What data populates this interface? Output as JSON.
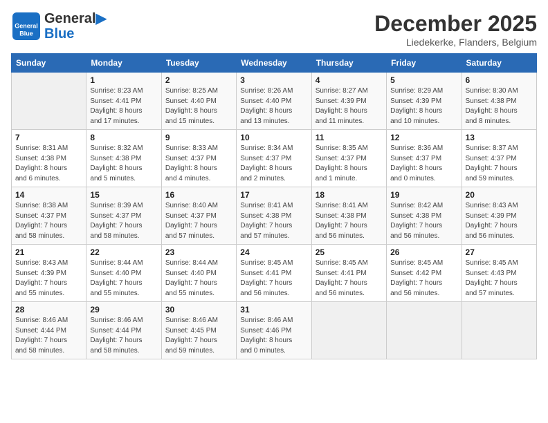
{
  "header": {
    "logo_line1": "General",
    "logo_line2": "Blue",
    "month": "December 2025",
    "location": "Liedekerke, Flanders, Belgium"
  },
  "weekdays": [
    "Sunday",
    "Monday",
    "Tuesday",
    "Wednesday",
    "Thursday",
    "Friday",
    "Saturday"
  ],
  "weeks": [
    [
      {
        "day": "",
        "info": ""
      },
      {
        "day": "1",
        "info": "Sunrise: 8:23 AM\nSunset: 4:41 PM\nDaylight: 8 hours\nand 17 minutes."
      },
      {
        "day": "2",
        "info": "Sunrise: 8:25 AM\nSunset: 4:40 PM\nDaylight: 8 hours\nand 15 minutes."
      },
      {
        "day": "3",
        "info": "Sunrise: 8:26 AM\nSunset: 4:40 PM\nDaylight: 8 hours\nand 13 minutes."
      },
      {
        "day": "4",
        "info": "Sunrise: 8:27 AM\nSunset: 4:39 PM\nDaylight: 8 hours\nand 11 minutes."
      },
      {
        "day": "5",
        "info": "Sunrise: 8:29 AM\nSunset: 4:39 PM\nDaylight: 8 hours\nand 10 minutes."
      },
      {
        "day": "6",
        "info": "Sunrise: 8:30 AM\nSunset: 4:38 PM\nDaylight: 8 hours\nand 8 minutes."
      }
    ],
    [
      {
        "day": "7",
        "info": "Sunrise: 8:31 AM\nSunset: 4:38 PM\nDaylight: 8 hours\nand 6 minutes."
      },
      {
        "day": "8",
        "info": "Sunrise: 8:32 AM\nSunset: 4:38 PM\nDaylight: 8 hours\nand 5 minutes."
      },
      {
        "day": "9",
        "info": "Sunrise: 8:33 AM\nSunset: 4:37 PM\nDaylight: 8 hours\nand 4 minutes."
      },
      {
        "day": "10",
        "info": "Sunrise: 8:34 AM\nSunset: 4:37 PM\nDaylight: 8 hours\nand 2 minutes."
      },
      {
        "day": "11",
        "info": "Sunrise: 8:35 AM\nSunset: 4:37 PM\nDaylight: 8 hours\nand 1 minute."
      },
      {
        "day": "12",
        "info": "Sunrise: 8:36 AM\nSunset: 4:37 PM\nDaylight: 8 hours\nand 0 minutes."
      },
      {
        "day": "13",
        "info": "Sunrise: 8:37 AM\nSunset: 4:37 PM\nDaylight: 7 hours\nand 59 minutes."
      }
    ],
    [
      {
        "day": "14",
        "info": "Sunrise: 8:38 AM\nSunset: 4:37 PM\nDaylight: 7 hours\nand 58 minutes."
      },
      {
        "day": "15",
        "info": "Sunrise: 8:39 AM\nSunset: 4:37 PM\nDaylight: 7 hours\nand 58 minutes."
      },
      {
        "day": "16",
        "info": "Sunrise: 8:40 AM\nSunset: 4:37 PM\nDaylight: 7 hours\nand 57 minutes."
      },
      {
        "day": "17",
        "info": "Sunrise: 8:41 AM\nSunset: 4:38 PM\nDaylight: 7 hours\nand 57 minutes."
      },
      {
        "day": "18",
        "info": "Sunrise: 8:41 AM\nSunset: 4:38 PM\nDaylight: 7 hours\nand 56 minutes."
      },
      {
        "day": "19",
        "info": "Sunrise: 8:42 AM\nSunset: 4:38 PM\nDaylight: 7 hours\nand 56 minutes."
      },
      {
        "day": "20",
        "info": "Sunrise: 8:43 AM\nSunset: 4:39 PM\nDaylight: 7 hours\nand 56 minutes."
      }
    ],
    [
      {
        "day": "21",
        "info": "Sunrise: 8:43 AM\nSunset: 4:39 PM\nDaylight: 7 hours\nand 55 minutes."
      },
      {
        "day": "22",
        "info": "Sunrise: 8:44 AM\nSunset: 4:40 PM\nDaylight: 7 hours\nand 55 minutes."
      },
      {
        "day": "23",
        "info": "Sunrise: 8:44 AM\nSunset: 4:40 PM\nDaylight: 7 hours\nand 55 minutes."
      },
      {
        "day": "24",
        "info": "Sunrise: 8:45 AM\nSunset: 4:41 PM\nDaylight: 7 hours\nand 56 minutes."
      },
      {
        "day": "25",
        "info": "Sunrise: 8:45 AM\nSunset: 4:41 PM\nDaylight: 7 hours\nand 56 minutes."
      },
      {
        "day": "26",
        "info": "Sunrise: 8:45 AM\nSunset: 4:42 PM\nDaylight: 7 hours\nand 56 minutes."
      },
      {
        "day": "27",
        "info": "Sunrise: 8:45 AM\nSunset: 4:43 PM\nDaylight: 7 hours\nand 57 minutes."
      }
    ],
    [
      {
        "day": "28",
        "info": "Sunrise: 8:46 AM\nSunset: 4:44 PM\nDaylight: 7 hours\nand 58 minutes."
      },
      {
        "day": "29",
        "info": "Sunrise: 8:46 AM\nSunset: 4:44 PM\nDaylight: 7 hours\nand 58 minutes."
      },
      {
        "day": "30",
        "info": "Sunrise: 8:46 AM\nSunset: 4:45 PM\nDaylight: 7 hours\nand 59 minutes."
      },
      {
        "day": "31",
        "info": "Sunrise: 8:46 AM\nSunset: 4:46 PM\nDaylight: 8 hours\nand 0 minutes."
      },
      {
        "day": "",
        "info": ""
      },
      {
        "day": "",
        "info": ""
      },
      {
        "day": "",
        "info": ""
      }
    ]
  ]
}
